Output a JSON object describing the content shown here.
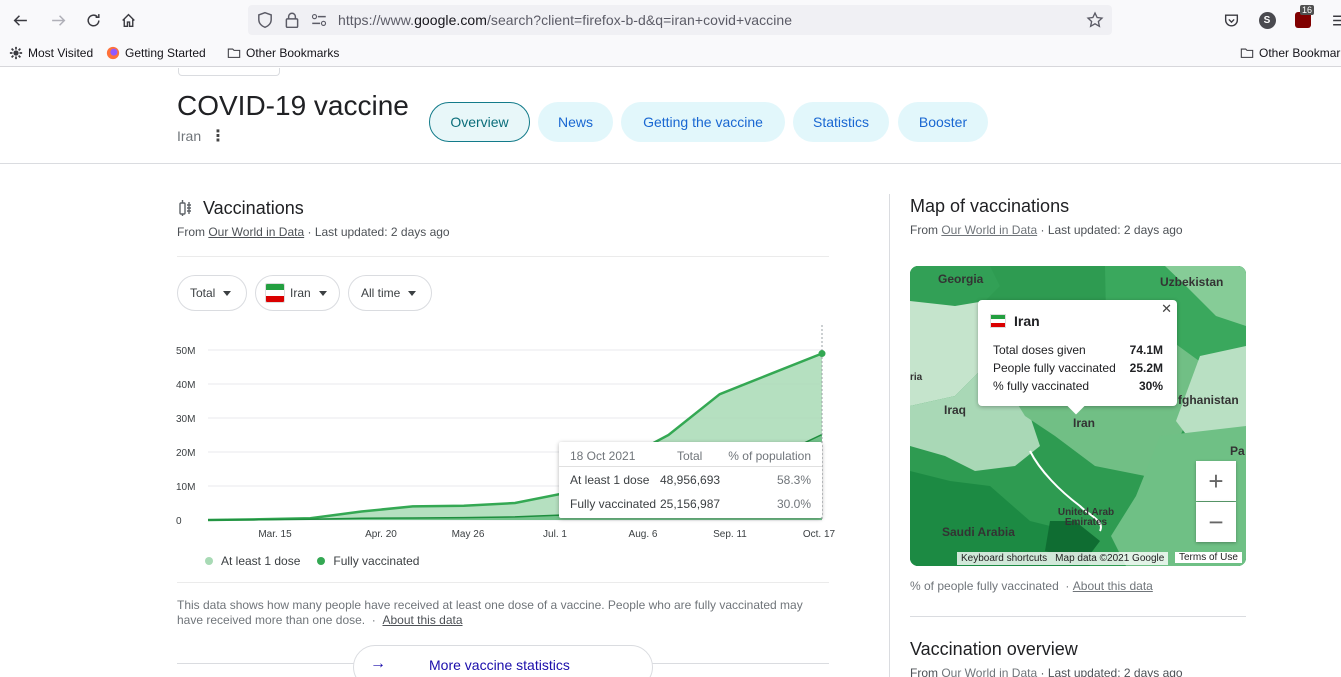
{
  "browser": {
    "url_prefix": "https://www.",
    "url_domain": "google.com",
    "url_suffix": "/search?client=firefox-b-d&q=iran+covid+vaccine",
    "extension_badge": "16",
    "profile_initial": "S",
    "bookmarks": [
      "Most Visited",
      "Getting Started",
      "Other Bookmarks"
    ],
    "bookmarks_right": "Other Bookmar"
  },
  "header": {
    "title": "COVID-19 vaccine",
    "subtitle": "Iran",
    "tabs": [
      "Overview",
      "News",
      "Getting the vaccine",
      "Statistics",
      "Booster"
    ]
  },
  "vaccinations": {
    "title": "Vaccinations",
    "source_prefix": "From ",
    "source_link": "Our World in Data",
    "source_suffix": " · Last updated: 2 days ago",
    "filters": {
      "metric": "Total",
      "country": "Iran",
      "range": "All time"
    },
    "legend": [
      "At least 1 dose",
      "Fully vaccinated"
    ],
    "note": "This data shows how many people have received at least one dose of a vaccine. People who are fully vaccinated may have received more than one dose.",
    "note_link": "About this data",
    "more_button": "More vaccine statistics"
  },
  "tooltip": {
    "date": "18 Oct 2021",
    "col_total": "Total",
    "col_pct": "% of population",
    "rows": [
      {
        "label": "At least 1 dose",
        "total": "48,956,693",
        "pct": "58.3%"
      },
      {
        "label": "Fully vaccinated",
        "total": "25,156,987",
        "pct": "30.0%"
      }
    ]
  },
  "chart_data": {
    "type": "area",
    "x": [
      "Feb 10",
      "Mar 15",
      "Apr 20",
      "May 26",
      "Jun 10",
      "Jul 1",
      "Jul 20",
      "Aug 6",
      "Aug 25",
      "Sep 11",
      "Sep 25",
      "Oct 5",
      "Oct 17"
    ],
    "x_ticks": [
      "Mar. 15",
      "Apr. 20",
      "May 26",
      "Jul. 1",
      "Aug. 6",
      "Sep. 11",
      "Oct. 17"
    ],
    "y_ticks": [
      "0",
      "10M",
      "20M",
      "30M",
      "40M",
      "50M"
    ],
    "ylim": [
      0,
      50000000
    ],
    "series": [
      {
        "name": "At least 1 dose",
        "color": "#81c995",
        "values": [
          0,
          200000,
          500000,
          2500000,
          4000000,
          4200000,
          5000000,
          8000000,
          17000000,
          25000000,
          37000000,
          43000000,
          48956693
        ]
      },
      {
        "name": "Fully vaccinated",
        "color": "#34a853",
        "values": [
          0,
          50000,
          200000,
          500000,
          600000,
          700000,
          900000,
          1500000,
          3500000,
          7000000,
          12000000,
          18000000,
          25156987
        ]
      }
    ]
  },
  "map": {
    "title": "Map of vaccinations",
    "source_prefix": "From ",
    "source_link": "Our World in Data",
    "source_suffix": " · Last updated: 2 days ago",
    "labels": [
      "Georgia",
      "Uzbekistan",
      "ria",
      "Iraq",
      "Iran",
      "fghanistan",
      "Pa",
      "Saudi Arabia",
      "United Arab Emirates"
    ],
    "popup": {
      "country": "Iran",
      "rows": [
        {
          "label": "Total doses given",
          "value": "74.1M"
        },
        {
          "label": "People fully vaccinated",
          "value": "25.2M"
        },
        {
          "label": "% fully vaccinated",
          "value": "30%"
        }
      ]
    },
    "attribution": [
      "Keyboard shortcuts",
      "Map data ©2021 Google",
      "Terms of Use"
    ],
    "footer": "% of people fully vaccinated",
    "footer_link": "About this data"
  },
  "overview": {
    "title": "Vaccination overview",
    "source_prefix": "From ",
    "source_link": "Our World in Data",
    "source_suffix": " · Last updated: 2 days ago"
  },
  "colors": {
    "accent": "#1a73e8",
    "series_dose": "#81c995",
    "series_full": "#34a853",
    "flag_green": "#239f40",
    "flag_red": "#da0000"
  }
}
